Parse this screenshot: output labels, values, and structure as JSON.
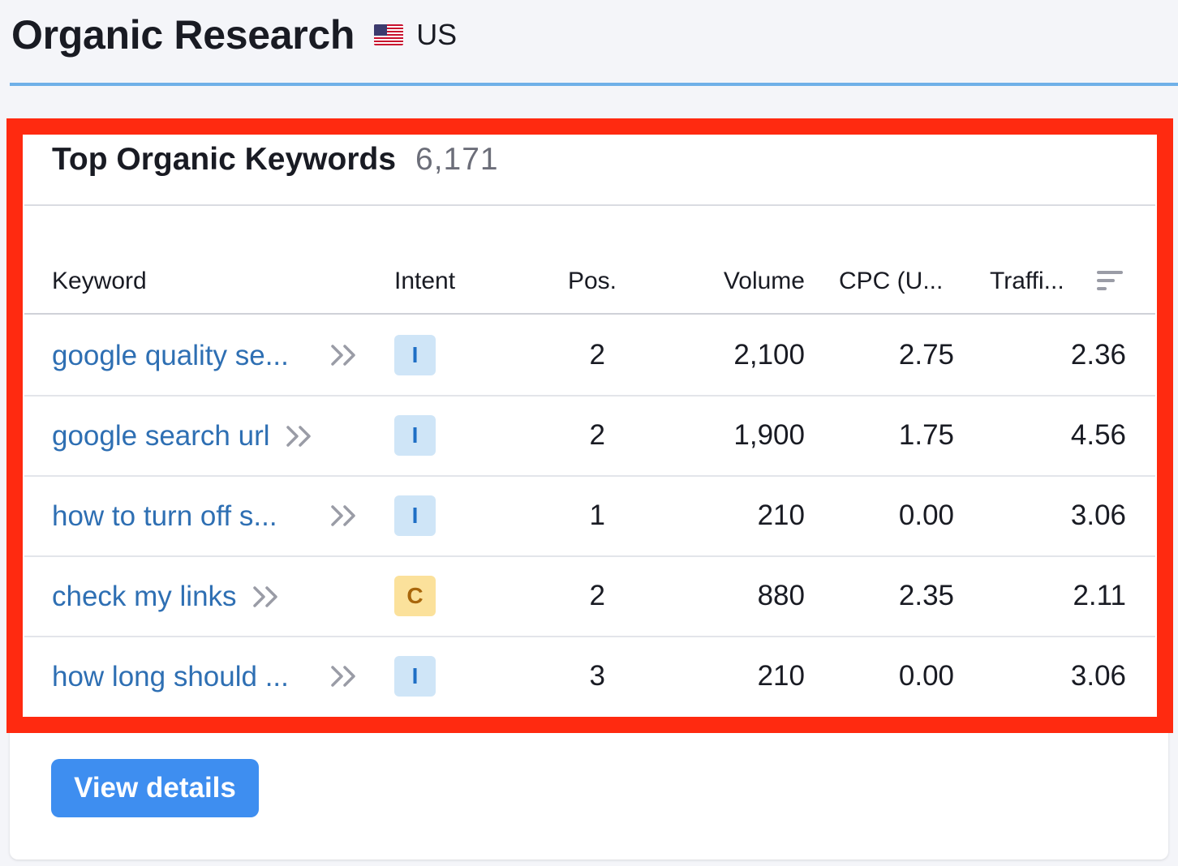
{
  "header": {
    "title": "Organic Research",
    "flag_icon": "us-flag-icon",
    "region": "US"
  },
  "widget": {
    "title": "Top Organic Keywords",
    "count": "6,171",
    "columns": {
      "keyword": "Keyword",
      "intent": "Intent",
      "pos": "Pos.",
      "volume": "Volume",
      "cpc": "CPC (U...",
      "traffic": "Traffi..."
    },
    "rows": [
      {
        "keyword": "google quality se...",
        "intent": "I",
        "pos": "2",
        "volume": "2,100",
        "cpc": "2.75",
        "traffic": "2.36"
      },
      {
        "keyword": "google search url",
        "intent": "I",
        "pos": "2",
        "volume": "1,900",
        "cpc": "1.75",
        "traffic": "4.56"
      },
      {
        "keyword": "how to turn off s...",
        "intent": "I",
        "pos": "1",
        "volume": "210",
        "cpc": "0.00",
        "traffic": "3.06"
      },
      {
        "keyword": "check my links",
        "intent": "C",
        "pos": "2",
        "volume": "880",
        "cpc": "2.35",
        "traffic": "2.11"
      },
      {
        "keyword": "how long should ...",
        "intent": "I",
        "pos": "3",
        "volume": "210",
        "cpc": "0.00",
        "traffic": "3.06"
      }
    ],
    "button_label": "View details"
  },
  "colors": {
    "highlight": "#ff2a10",
    "link": "#2e6fb3",
    "button": "#3e8ef0",
    "intent_informational": "#cfe5f7",
    "intent_commercial": "#fbe19b"
  }
}
